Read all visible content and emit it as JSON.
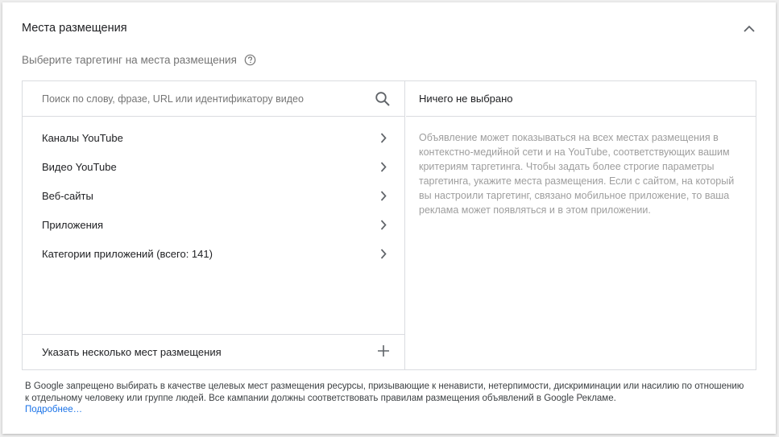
{
  "section": {
    "title": "Места размещения",
    "subtitle": "Выберите таргетинг на места размещения"
  },
  "search": {
    "placeholder": "Поиск по слову, фразе, URL или идентификатору видео"
  },
  "categories": [
    {
      "label": "Каналы YouTube"
    },
    {
      "label": "Видео YouTube"
    },
    {
      "label": "Веб-сайты"
    },
    {
      "label": "Приложения"
    },
    {
      "label": "Категории приложений (всего: 141)"
    }
  ],
  "multi_add": {
    "label": "Указать несколько мест размещения"
  },
  "selection": {
    "title": "Ничего не выбрано",
    "description": "Объявление может показываться на всех местах размещения в контекстно-медийной сети и на YouTube, соответствующих вашим критериям таргетинга. Чтобы задать более строгие параметры таргетинга, укажите места размещения. Если с сайтом, на который вы настроили таргетинг, связано мобильное приложение, то ваша реклама может появляться и в этом приложении."
  },
  "footer": {
    "text": "В Google запрещено выбирать в качестве целевых мест размещения ресурсы, призывающие к ненависти, нетерпимости, дискриминации или насилию по отношению к отдельному человеку или группе людей. Все кампании должны соответствовать правилам размещения объявлений в Google Рекламе.",
    "link": "Подробнее…"
  },
  "icons": {
    "collapse": "chevron-up-icon",
    "help": "help-circle-icon",
    "search": "search-icon",
    "item_arrow": "chevron-right-icon",
    "add": "plus-icon"
  },
  "colors": {
    "link": "#1a73e8",
    "muted_text": "#9e9e9e",
    "border": "#dadce0"
  }
}
